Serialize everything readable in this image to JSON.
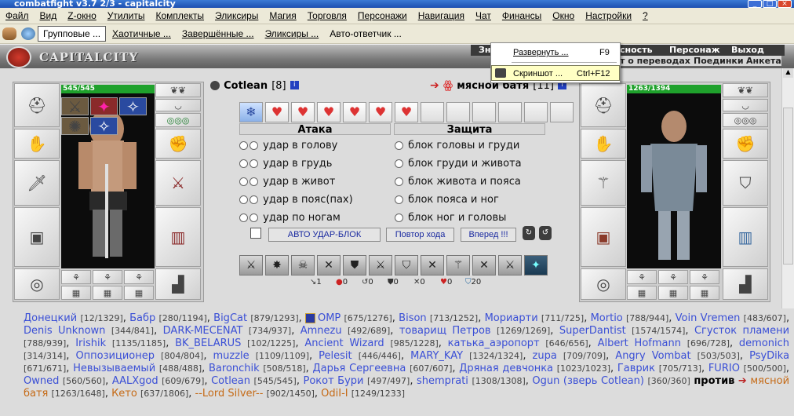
{
  "window": {
    "title": "combatfight v3.7 2/3 - capitalcity"
  },
  "menu": [
    "Файл",
    "Вид",
    "Z-окно",
    "Утилиты",
    "Комплекты",
    "Эликсиры",
    "Магия",
    "Торговля",
    "Персонажи",
    "Навигация",
    "Чат",
    "Финансы",
    "Окно",
    "Настройки",
    "?"
  ],
  "toolbar": [
    "Групповые ...",
    "Хаотичные ...",
    "Завершённые ...",
    "Эликсиры ...",
    "Авто-ответчик ..."
  ],
  "game": {
    "logo": "CAPITALCITY",
    "menu_top": [
      "Зн",
      "сность",
      "Персонаж",
      "Выход"
    ],
    "menu_sub": [
      "т о переводах",
      "Поединки",
      "Анкета"
    ]
  },
  "popup": {
    "items": [
      {
        "label": "Развернуть ...",
        "key": "F9"
      },
      {
        "label": "Скриншот ...",
        "key": "Ctrl+F12"
      }
    ]
  },
  "left": {
    "name": "Cotlean",
    "level": "[8]",
    "hp": "545/545"
  },
  "right": {
    "name": "мясной батя",
    "level": "[11]",
    "hp": "1263/1394"
  },
  "combat": {
    "attack_header": "Атака",
    "defense_header": "Защита",
    "attacks": [
      "удар в голову",
      "удар в грудь",
      "удар в живот",
      "удар в пояс(пах)",
      "удар по ногам"
    ],
    "defenses": [
      "блок головы и груди",
      "блок груди и живота",
      "блок живота и пояса",
      "блок пояса и ног",
      "блок ног и головы"
    ],
    "buttons": {
      "auto": "АВТО УДАР-БЛОК",
      "repeat": "Повтор хода",
      "forward": "Вперед !!!"
    },
    "stats": [
      "1",
      "0",
      "0",
      "0",
      "0",
      "0",
      "20"
    ]
  },
  "players": {
    "label_vs": "против",
    "team1": [
      [
        "Донецкий",
        "[12/1329]"
      ],
      [
        "Бабр",
        "[280/1194]"
      ],
      [
        "BigCat",
        "[879/1293]"
      ],
      [
        "OMP",
        "[675/1276]"
      ],
      [
        "Bison",
        "[713/1252]"
      ],
      [
        "Мориарти",
        "[711/725]"
      ],
      [
        "Mortio",
        "[788/944]"
      ],
      [
        "Voin Vremen",
        "[483/607]"
      ],
      [
        "Denis Unknown",
        "[344/841]"
      ],
      [
        "DARK-MECENAT",
        "[734/937]"
      ],
      [
        "Amnezu",
        "[492/689]"
      ],
      [
        "товарищ Петров",
        "[1269/1269]"
      ],
      [
        "SuperDantist",
        "[1574/1574]"
      ],
      [
        "Сгусток пламени",
        "[788/939]"
      ],
      [
        "Irishik",
        "[1135/1185]"
      ],
      [
        "BK_BELARUS",
        "[102/1225]"
      ],
      [
        "Ancient Wizard",
        "[985/1228]"
      ],
      [
        "катька_аэропорт",
        "[646/656]"
      ],
      [
        "Albert Hofmann",
        "[696/728]"
      ],
      [
        "demonich",
        "[314/314]"
      ],
      [
        "Оппозиционер",
        "[804/804]"
      ],
      [
        "muzzle",
        "[1109/1109]"
      ],
      [
        "Pelesit",
        "[446/446]"
      ],
      [
        "MARY_KAY",
        "[1324/1324]"
      ],
      [
        "zupa",
        "[709/709]"
      ],
      [
        "Angry Vombat",
        "[503/503]"
      ],
      [
        "PsyDika",
        "[671/671]"
      ],
      [
        "Невызываемый",
        "[488/488]"
      ],
      [
        "Baronchik",
        "[508/518]"
      ],
      [
        "Дарья Сергеевна",
        "[607/607]"
      ],
      [
        "Дряная девчонка",
        "[1023/1023]"
      ],
      [
        "Гаврик",
        "[705/713]"
      ],
      [
        "FURIO",
        "[500/500]"
      ],
      [
        "Owned",
        "[560/560]"
      ],
      [
        "AALXgod",
        "[609/679]"
      ],
      [
        "Cotlean",
        "[545/545]"
      ],
      [
        "Рокот Бури",
        "[497/497]"
      ],
      [
        "shemprati",
        "[1308/1308]"
      ],
      [
        "Ogun (зверь Cotlean)",
        "[360/360]"
      ]
    ],
    "team2": [
      [
        "мясной батя",
        "[1263/1648]"
      ],
      [
        "Кето",
        "[637/1806]"
      ],
      [
        "--Lord Silver--",
        "[902/1450]"
      ],
      [
        "OdiI-I",
        "[1249/1233]"
      ]
    ]
  }
}
